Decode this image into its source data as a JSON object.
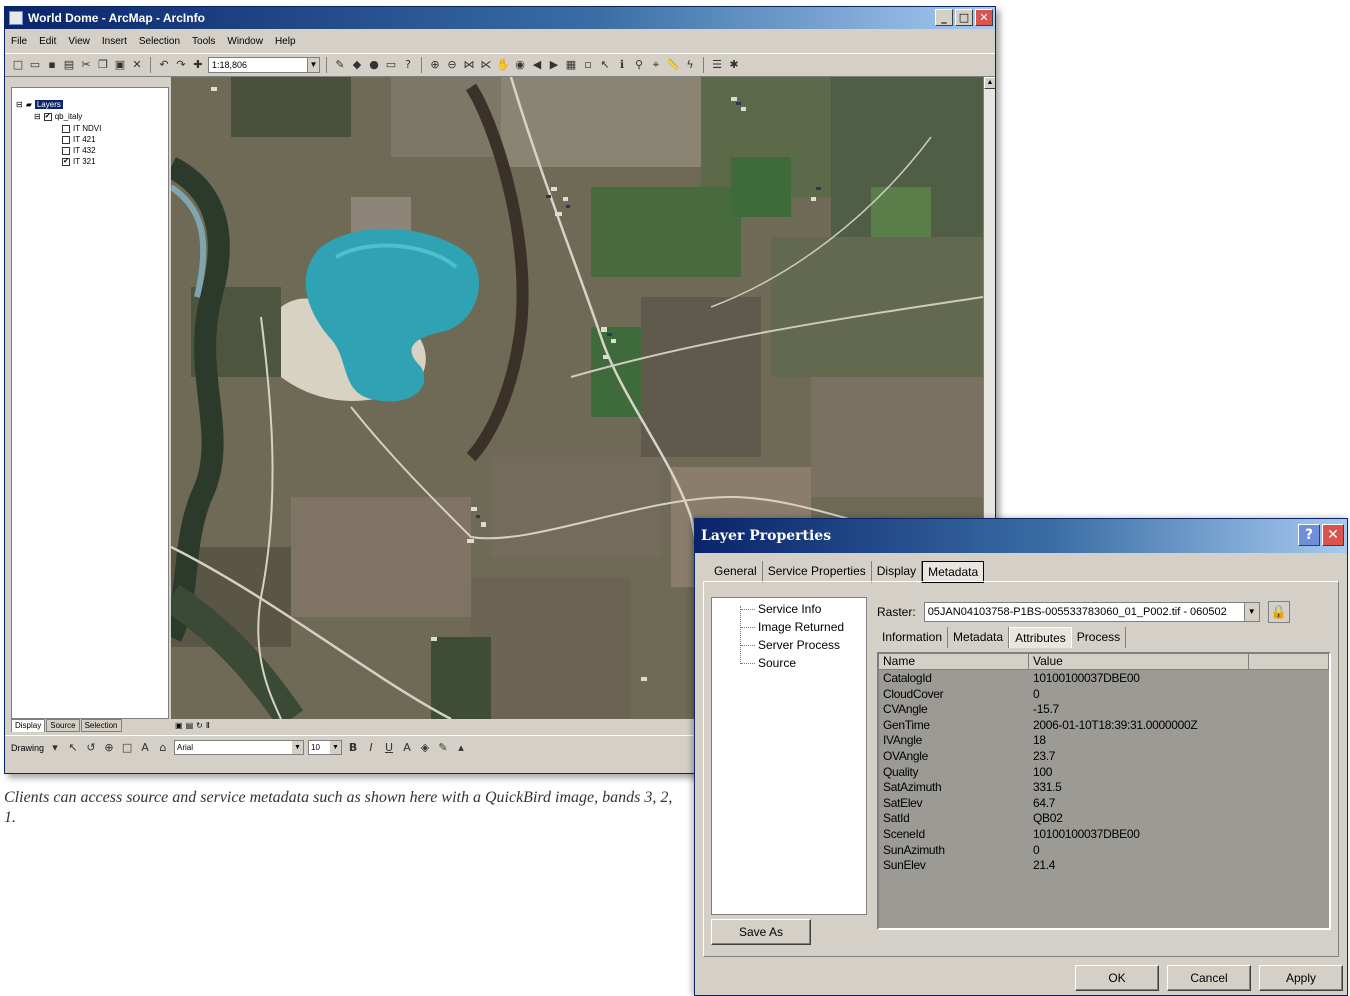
{
  "arcmap": {
    "title": "World Dome - ArcMap - ArcInfo",
    "menu": [
      "File",
      "Edit",
      "View",
      "Insert",
      "Selection",
      "Tools",
      "Window",
      "Help"
    ],
    "scale": "1:18,806",
    "toc": {
      "root": "Layers",
      "group": "qb_italy",
      "layers": [
        {
          "name": "IT NDVI",
          "checked": false
        },
        {
          "name": "IT 421",
          "checked": false
        },
        {
          "name": "IT 432",
          "checked": false
        },
        {
          "name": "IT 321",
          "checked": true
        }
      ],
      "tabs": [
        "Display",
        "Source",
        "Selection"
      ]
    },
    "drawing": {
      "label": "Drawing",
      "font": "Arial",
      "size": "10"
    }
  },
  "caption": "Clients can access source and service metadata such as shown here with a QuickBird image, bands 3, 2, 1.",
  "dialog": {
    "title": "Layer Properties",
    "tabs": [
      "General",
      "Service Properties",
      "Display",
      "Metadata"
    ],
    "active_tab": "Metadata",
    "tree": [
      "Service Info",
      "Image Returned",
      "Server Process",
      "Source"
    ],
    "save_as": "Save As",
    "raster_label": "Raster:",
    "raster_value": "05JAN04103758-P1BS-005533783060_01_P002.tif - 060502",
    "inner_tabs": [
      "Information",
      "Metadata",
      "Attributes",
      "Process"
    ],
    "active_inner_tab": "Attributes",
    "columns": [
      "Name",
      "Value"
    ],
    "rows": [
      [
        "CatalogId",
        "10100100037DBE00"
      ],
      [
        "CloudCover",
        "0"
      ],
      [
        "CVAngle",
        "-15.7"
      ],
      [
        "GenTime",
        "2006-01-10T18:39:31.0000000Z"
      ],
      [
        "IVAngle",
        "18"
      ],
      [
        "OVAngle",
        "23.7"
      ],
      [
        "Quality",
        "100"
      ],
      [
        "SatAzimuth",
        "331.5"
      ],
      [
        "SatElev",
        "64.7"
      ],
      [
        "SatId",
        "QB02"
      ],
      [
        "SceneId",
        "10100100037DBE00"
      ],
      [
        "SunAzimuth",
        "0"
      ],
      [
        "SunElev",
        "21.4"
      ]
    ],
    "buttons": {
      "ok": "OK",
      "cancel": "Cancel",
      "apply": "Apply"
    }
  },
  "icons": [
    "app-icon",
    "minimize-icon",
    "maximize-icon",
    "close-icon",
    "help-icon",
    "lock-icon",
    "dropdown-arrow-icon"
  ],
  "colors": {
    "titlebar": "#0a246a",
    "lake": "#2fa3b4",
    "face": "#d4d0c8"
  }
}
